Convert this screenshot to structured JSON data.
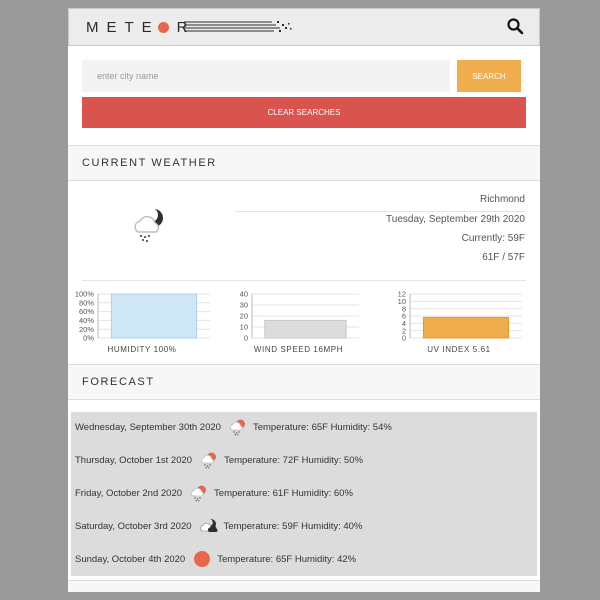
{
  "app": {
    "logo": "METEOR"
  },
  "search": {
    "placeholder": "enter city name",
    "value": "",
    "button_label": "SEARCH",
    "clear_label": "CLEAR SEARCHES"
  },
  "current": {
    "section_title": "CURRENT WEATHER",
    "icon": "cloud-rain-night-icon",
    "city": "Richmond",
    "date": "Tuesday, September 29th 2020",
    "currently": "Currently: 59F",
    "hilo": "61F / 57F"
  },
  "charts": [
    {
      "type": "bar",
      "label": "HUMIDITY 100%",
      "value": 100,
      "ylim": [
        0,
        100
      ],
      "ticks": [
        "0%",
        "20%",
        "40%",
        "60%",
        "80%",
        "100%"
      ],
      "color": "#cfe6f5",
      "stroke": "#a8d2ee"
    },
    {
      "type": "bar",
      "label": "WIND SPEED 16MPH",
      "value": 16,
      "ylim": [
        0,
        40
      ],
      "ticks": [
        "0",
        "10",
        "20",
        "30",
        "40"
      ],
      "color": "#dcdcdc",
      "stroke": "#c8c8c8"
    },
    {
      "type": "bar",
      "label": "UV INDEX 5.61",
      "value": 5.61,
      "ylim": [
        0,
        12
      ],
      "ticks": [
        "0",
        "2",
        "4",
        "6",
        "8",
        "10",
        "12"
      ],
      "color": "#f0ad4e",
      "stroke": "#e89a2e"
    }
  ],
  "forecast": {
    "section_title": "FORECAST",
    "days": [
      {
        "date": "Wednesday, September 30th 2020",
        "icon": "cloud-rain-sun-icon",
        "detail": "Temperature: 65F Humidity: 54%"
      },
      {
        "date": "Thursday, October 1st 2020",
        "icon": "cloud-rain-sun-icon",
        "detail": "Temperature: 72F Humidity: 50%"
      },
      {
        "date": "Friday, October 2nd 2020",
        "icon": "cloud-rain-sun-icon",
        "detail": "Temperature: 61F Humidity: 60%"
      },
      {
        "date": "Saturday, October 3rd 2020",
        "icon": "cloud-night-icon",
        "detail": "Temperature: 59F Humidity: 40%"
      },
      {
        "date": "Sunday, October 4th 2020",
        "icon": "sun-icon",
        "detail": "Temperature: 65F Humidity: 42%"
      }
    ]
  },
  "colors": {
    "accent": "#f0ad4e",
    "danger": "#d9534f",
    "sun": "#e8664c"
  }
}
